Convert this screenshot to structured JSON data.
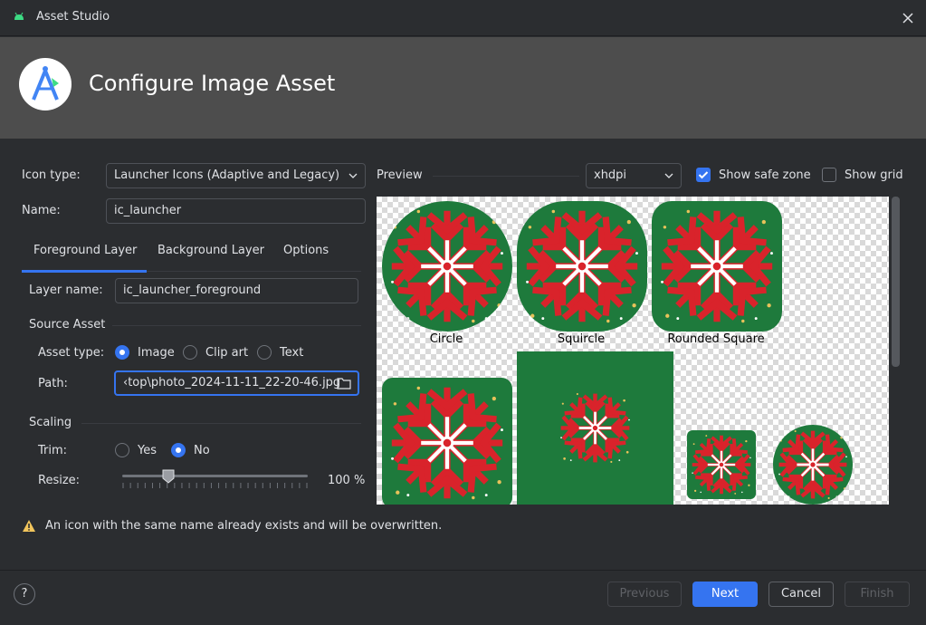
{
  "window": {
    "title": "Asset Studio"
  },
  "header": {
    "title": "Configure Image Asset"
  },
  "form": {
    "icon_type_label": "Icon type:",
    "icon_type_value": "Launcher Icons (Adaptive and Legacy)",
    "name_label": "Name:",
    "name_value": "ic_launcher"
  },
  "tabs": [
    {
      "label": "Foreground Layer",
      "active": true
    },
    {
      "label": "Background Layer",
      "active": false
    },
    {
      "label": "Options",
      "active": false
    }
  ],
  "layer": {
    "layer_name_label": "Layer name:",
    "layer_name_value": "ic_launcher_foreground",
    "source_asset_heading": "Source Asset",
    "asset_type_label": "Asset type:",
    "asset_types": [
      {
        "label": "Image",
        "selected": true
      },
      {
        "label": "Clip art",
        "selected": false
      },
      {
        "label": "Text",
        "selected": false
      }
    ],
    "path_label": "Path:",
    "path_value": "‹top\\photo_2024-11-11_22-20-46.jpg",
    "scaling_heading": "Scaling",
    "trim_label": "Trim:",
    "trim_options": [
      {
        "label": "Yes",
        "selected": false
      },
      {
        "label": "No",
        "selected": true
      }
    ],
    "resize_label": "Resize:",
    "resize_value": 100,
    "resize_display": "100 %"
  },
  "preview": {
    "label": "Preview",
    "density": "xhdpi",
    "show_safe_zone_label": "Show safe zone",
    "show_safe_zone": true,
    "show_grid_label": "Show grid",
    "show_grid": false,
    "shapes": [
      "Circle",
      "Squircle",
      "Rounded Square"
    ]
  },
  "warning": {
    "text": "An icon with the same name already exists and will be overwritten."
  },
  "footer": {
    "help": "?",
    "previous": "Previous",
    "next": "Next",
    "cancel": "Cancel",
    "finish": "Finish"
  },
  "colors": {
    "accent": "#3574f0",
    "icon_green": "#1e7a3c",
    "icon_red": "#d9232b",
    "warning": "#f2c55c"
  }
}
